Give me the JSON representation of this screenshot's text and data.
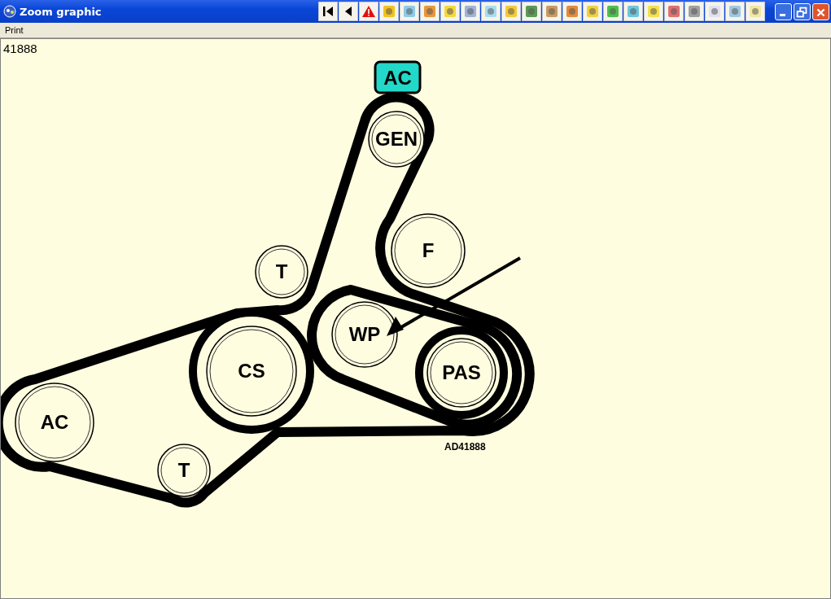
{
  "window": {
    "title": "Zoom graphic"
  },
  "menu": [
    "Print"
  ],
  "graphic": {
    "number": "41888",
    "badge": "AC",
    "caption": "AD41888",
    "pulleys": [
      {
        "label": "GEN"
      },
      {
        "label": "F"
      },
      {
        "label": "T"
      },
      {
        "label": "WP"
      },
      {
        "label": "CS"
      },
      {
        "label": "PAS"
      },
      {
        "label": "AC"
      },
      {
        "label": "T"
      }
    ]
  }
}
